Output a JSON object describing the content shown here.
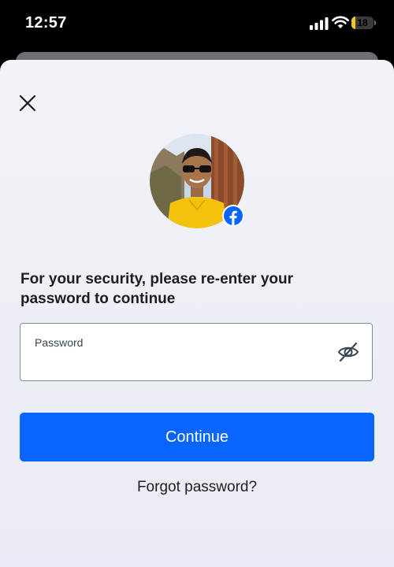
{
  "status_bar": {
    "time": "12:57",
    "battery_level": "18",
    "battery_fraction": 0.18,
    "battery_color": "#f3c623"
  },
  "dialog": {
    "close_icon": "close-icon",
    "avatar_badge_icon": "facebook-logo-icon",
    "prompt": "For your security, please re-enter your password to continue",
    "password_field": {
      "label": "Password",
      "value": "",
      "visibility_icon": "eye-slash-icon"
    },
    "continue_label": "Continue",
    "forgot_label": "Forgot password?"
  },
  "colors": {
    "primary_button": "#0866ff",
    "facebook_blue": "#0866ff",
    "text": "#1c1e21"
  }
}
